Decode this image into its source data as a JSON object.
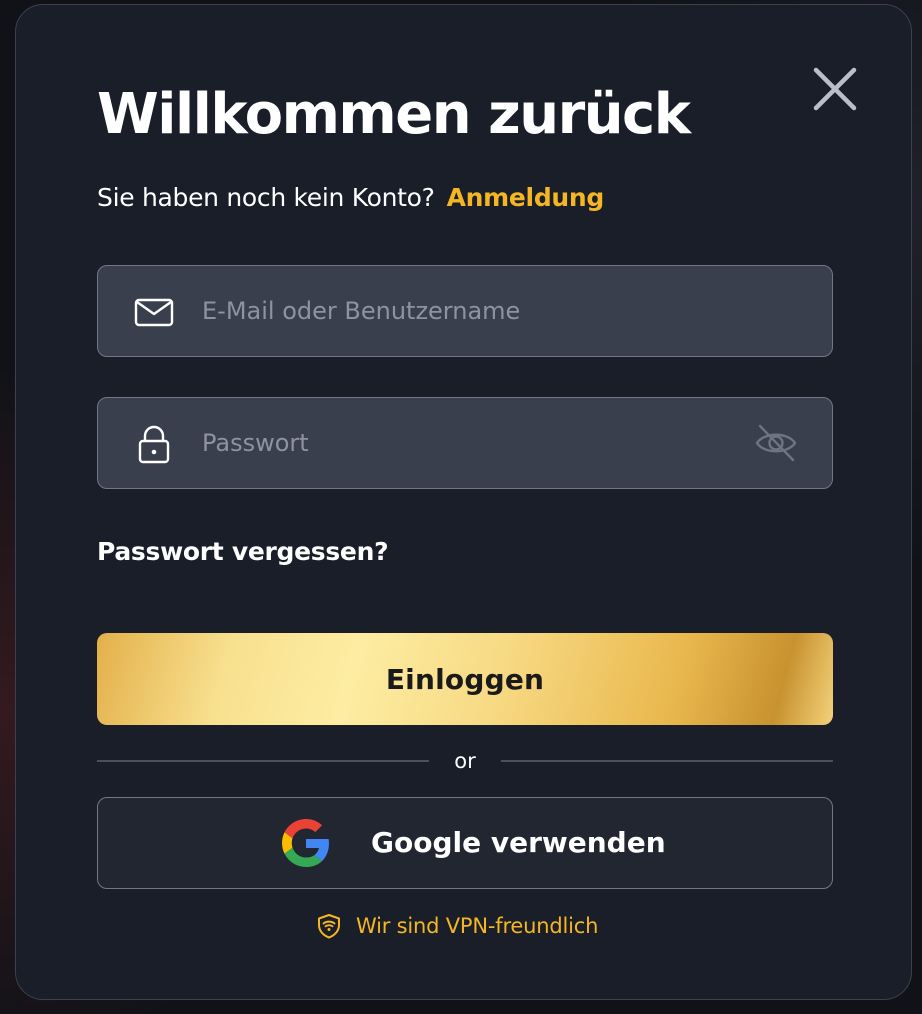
{
  "dialog": {
    "title": "Willkommen zurück",
    "subtitle_prefix": "Sie haben noch kein Konto?",
    "signup_link": "Anmeldung",
    "close_icon": "close-icon"
  },
  "form": {
    "email": {
      "placeholder": "E-Mail oder Benutzername",
      "value": "",
      "icon": "mail-icon"
    },
    "password": {
      "placeholder": "Passwort",
      "value": "",
      "icon": "lock-icon",
      "toggle_icon": "eye-off-icon"
    },
    "forgot_password": "Passwort vergessen?",
    "submit_label": "Einloggen"
  },
  "divider": {
    "text": "or"
  },
  "social": {
    "google_label": "Google verwenden",
    "google_icon": "google-icon"
  },
  "footer": {
    "vpn_text": "Wir sind VPN-freundlich",
    "vpn_icon": "shield-wifi-icon"
  },
  "colors": {
    "modal_background": "#1a1e28",
    "accent": "#f5b623",
    "input_background": "#3a3f4d",
    "input_border": "#717786",
    "gold_gradient_start": "#f8e08f",
    "gold_gradient_end": "#c89230"
  }
}
